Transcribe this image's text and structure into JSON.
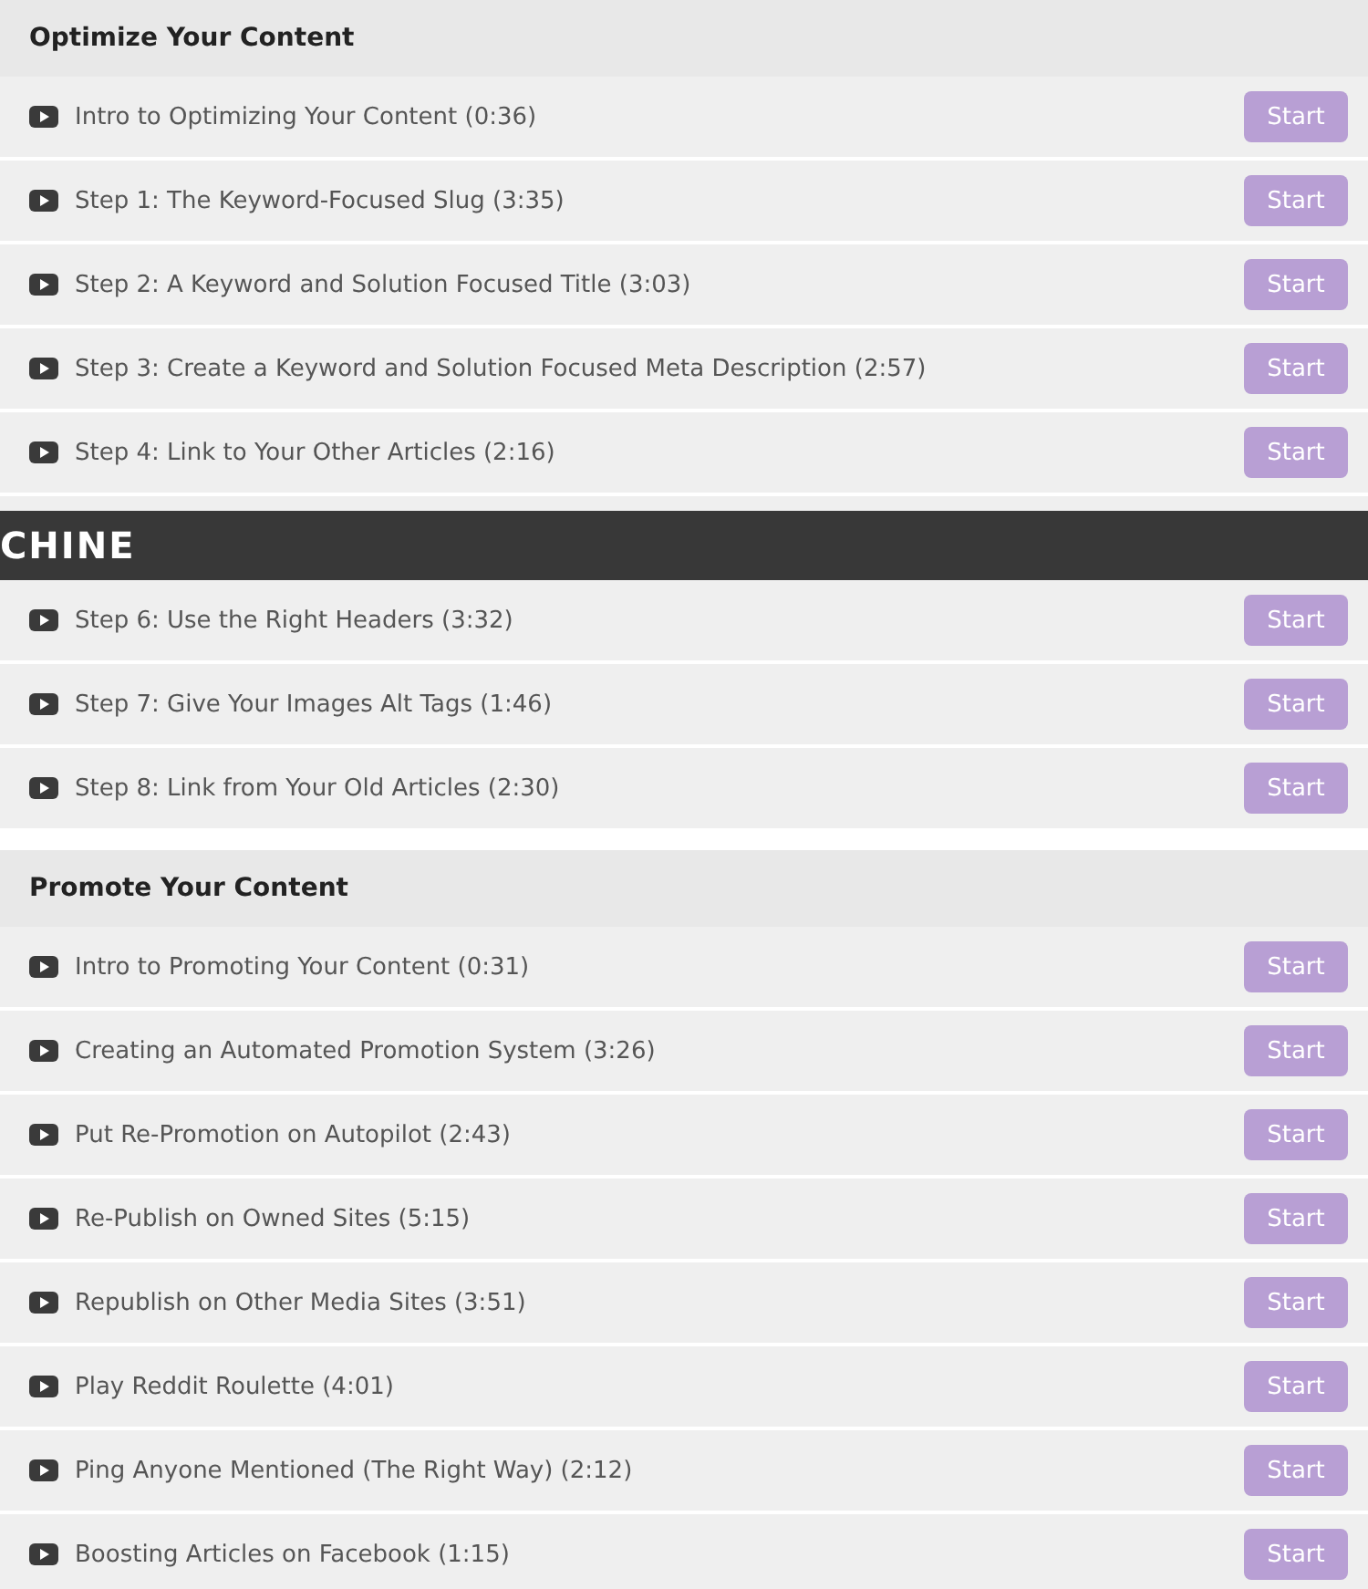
{
  "sections": [
    {
      "title": "Optimize Your Content",
      "lessons": [
        {
          "kind": "lesson",
          "title": "Intro to Optimizing Your Content (0:36)",
          "button": "Start"
        },
        {
          "kind": "lesson",
          "title": "Step 1: The Keyword-Focused Slug (3:35)",
          "button": "Start"
        },
        {
          "kind": "lesson",
          "title": "Step 2: A Keyword and Solution Focused Title (3:03)",
          "button": "Start"
        },
        {
          "kind": "lesson",
          "title": "Step 3: Create a Keyword and Solution Focused Meta Description (2:57)",
          "button": "Start"
        },
        {
          "kind": "lesson",
          "title": "Step 4: Link to Your Other Articles (2:16)",
          "button": "Start"
        },
        {
          "kind": "covered"
        },
        {
          "kind": "lesson",
          "title": "Step 6: Use the Right Headers (3:32)",
          "button": "Start"
        },
        {
          "kind": "lesson",
          "title": "Step 7: Give Your Images Alt Tags (1:46)",
          "button": "Start"
        },
        {
          "kind": "lesson",
          "title": "Step 8: Link from Your Old Articles (2:30)",
          "button": "Start"
        }
      ]
    },
    {
      "title": "Promote Your Content",
      "lessons": [
        {
          "kind": "lesson",
          "title": "Intro to Promoting Your Content (0:31)",
          "button": "Start"
        },
        {
          "kind": "lesson",
          "title": "Creating an Automated Promotion System (3:26)",
          "button": "Start"
        },
        {
          "kind": "lesson",
          "title": "Put Re-Promotion on Autopilot (2:43)",
          "button": "Start"
        },
        {
          "kind": "lesson",
          "title": "Re-Publish on Owned Sites (5:15)",
          "button": "Start"
        },
        {
          "kind": "lesson",
          "title": "Republish on Other Media Sites (3:51)",
          "button": "Start"
        },
        {
          "kind": "lesson",
          "title": "Play Reddit Roulette (4:01)",
          "button": "Start"
        },
        {
          "kind": "lesson",
          "title": "Ping Anyone Mentioned (The Right Way) (2:12)",
          "button": "Start"
        },
        {
          "kind": "lesson",
          "title": "Boosting Articles on Facebook (1:15)",
          "button": "Start"
        }
      ]
    }
  ],
  "overlay_banner": {
    "text": "CHINE"
  }
}
